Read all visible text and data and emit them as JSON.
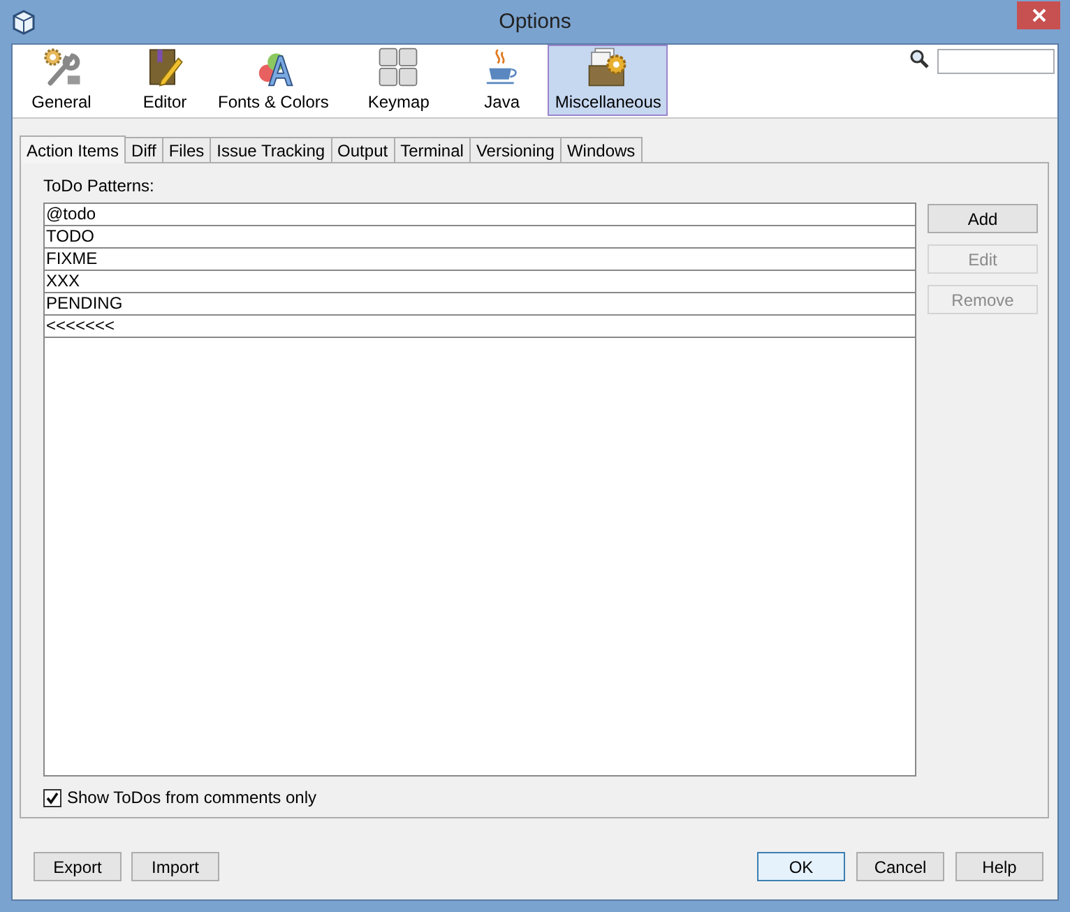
{
  "window": {
    "title": "Options"
  },
  "categories": [
    {
      "label": "General",
      "kind": "general",
      "selected": false
    },
    {
      "label": "Editor",
      "kind": "editor",
      "selected": false
    },
    {
      "label": "Fonts & Colors",
      "kind": "fonts",
      "selected": false
    },
    {
      "label": "Keymap",
      "kind": "keymap",
      "selected": false
    },
    {
      "label": "Java",
      "kind": "java",
      "selected": false
    },
    {
      "label": "Miscellaneous",
      "kind": "misc",
      "selected": true
    }
  ],
  "tabs": [
    {
      "label": "Action Items",
      "selected": true
    },
    {
      "label": "Diff",
      "selected": false
    },
    {
      "label": "Files",
      "selected": false
    },
    {
      "label": "Issue Tracking",
      "selected": false
    },
    {
      "label": "Output",
      "selected": false
    },
    {
      "label": "Terminal",
      "selected": false
    },
    {
      "label": "Versioning",
      "selected": false
    },
    {
      "label": "Windows",
      "selected": false
    }
  ],
  "todo_patterns": {
    "label": "ToDo Patterns:",
    "rows": [
      "@todo",
      "TODO",
      "FIXME",
      "XXX",
      "PENDING",
      "<<<<<<<"
    ]
  },
  "side_buttons": [
    {
      "label": "Add",
      "disabled": false
    },
    {
      "label": "Edit",
      "disabled": true
    },
    {
      "label": "Remove",
      "disabled": true
    }
  ],
  "show_todos": {
    "label": "Show ToDos from comments only",
    "checked": true
  },
  "footer_left_buttons": [
    {
      "label": "Export",
      "default": false
    },
    {
      "label": "Import",
      "default": false
    }
  ],
  "footer_right_buttons": [
    {
      "label": "OK",
      "default": true
    },
    {
      "label": "Cancel",
      "default": false
    },
    {
      "label": "Help",
      "default": false
    }
  ]
}
